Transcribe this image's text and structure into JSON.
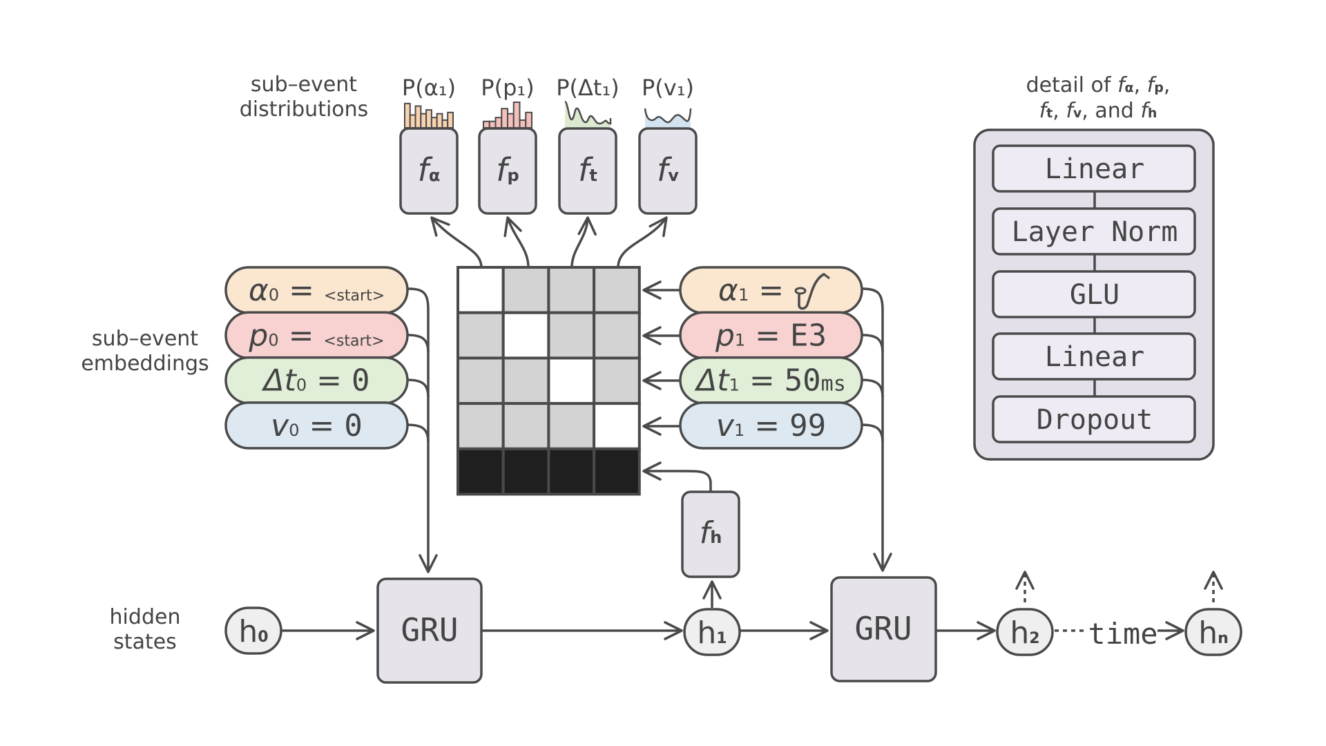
{
  "labels": {
    "distributions": [
      "sub–event",
      "distributions"
    ],
    "embeddings": [
      "sub–event",
      "embeddings"
    ],
    "hidden_states": [
      "hidden",
      "states"
    ],
    "time": "time"
  },
  "heads": [
    {
      "prob": "P(α₁)",
      "fn": "f",
      "sub": "α",
      "dist_type": "bars",
      "fill": "#f8d3b0",
      "heights": [
        0.95,
        0.5,
        0.85,
        0.55,
        0.7,
        0.4,
        0.55,
        0.3,
        0.6
      ]
    },
    {
      "prob": "P(p₁)",
      "fn": "f",
      "sub": "p",
      "dist_type": "bars",
      "fill": "#f3c0bc",
      "heights": [
        0.25,
        0.25,
        0.4,
        0.75,
        0.55,
        1.0,
        0.3,
        0.6
      ]
    },
    {
      "prob": "P(Δt₁)",
      "fn": "f",
      "sub": "t",
      "dist_type": "curve",
      "fill": "#dcebd0",
      "shape": "decay"
    },
    {
      "prob": "P(v₁)",
      "fn": "f",
      "sub": "v",
      "dist_type": "curve",
      "fill": "#d3e3f0",
      "shape": "wave"
    }
  ],
  "left_embeddings": [
    {
      "var": "α",
      "sub": "0",
      "eq": " = ",
      "value": "<start>",
      "small": true,
      "fill": "#fbe6d0"
    },
    {
      "var": "p",
      "sub": "0",
      "eq": " = ",
      "value": "<start>",
      "small": true,
      "fill": "#f7d2d0"
    },
    {
      "var": "Δt",
      "sub": "0",
      "eq": " = ",
      "value": " 0",
      "small": false,
      "fill": "#e1efd8"
    },
    {
      "var": "v",
      "sub": "0",
      "eq": " = ",
      "value": " 0",
      "small": false,
      "fill": "#dde8f1"
    }
  ],
  "right_embeddings": [
    {
      "var": "α",
      "sub": "1",
      "eq": " = ",
      "value": "saxophone-icon",
      "is_icon": true,
      "fill": "#fbe6d0"
    },
    {
      "var": "p",
      "sub": "1",
      "eq": " = ",
      "value": "E3",
      "fill": "#f7d2d0"
    },
    {
      "var": "Δt",
      "sub": "1",
      "eq": " = ",
      "value": "50",
      "unit": "ms",
      "fill": "#e1efd8"
    },
    {
      "var": "v",
      "sub": "1",
      "eq": " = ",
      "value": "99",
      "fill": "#dde8f1"
    }
  ],
  "mask_matrix": {
    "rows": [
      [
        "white",
        "gray",
        "gray",
        "gray"
      ],
      [
        "gray",
        "white",
        "gray",
        "gray"
      ],
      [
        "gray",
        "gray",
        "white",
        "gray"
      ],
      [
        "gray",
        "gray",
        "gray",
        "white"
      ],
      [
        "black",
        "black",
        "black",
        "black"
      ]
    ],
    "colors": {
      "white": "#ffffff",
      "gray": "#d3d3d3",
      "black": "#1f1f1f"
    }
  },
  "fh": {
    "fn": "f",
    "sub": "h"
  },
  "gru_label": "GRU",
  "hidden": [
    {
      "h": "h",
      "sub": "0"
    },
    {
      "h": "h",
      "sub": "1"
    },
    {
      "h": "h",
      "sub": "2"
    },
    {
      "h": "h",
      "sub": "n"
    }
  ],
  "detail": {
    "title_line1": [
      "detail of ",
      "f",
      "α",
      ", ",
      "f",
      "p",
      ","
    ],
    "title_line2": [
      "f",
      "t",
      ", ",
      "f",
      "v",
      ", and ",
      "f",
      "h"
    ],
    "layers": [
      "Linear",
      "Layer Norm",
      "GLU",
      "Linear",
      "Dropout"
    ]
  },
  "colors": {
    "stroke": "#4a4a4a",
    "box_fill": "#e6e3ea",
    "panel_fill": "#e4e0ea",
    "layer_fill": "#efebf4",
    "hidden_fill": "#efefef"
  }
}
